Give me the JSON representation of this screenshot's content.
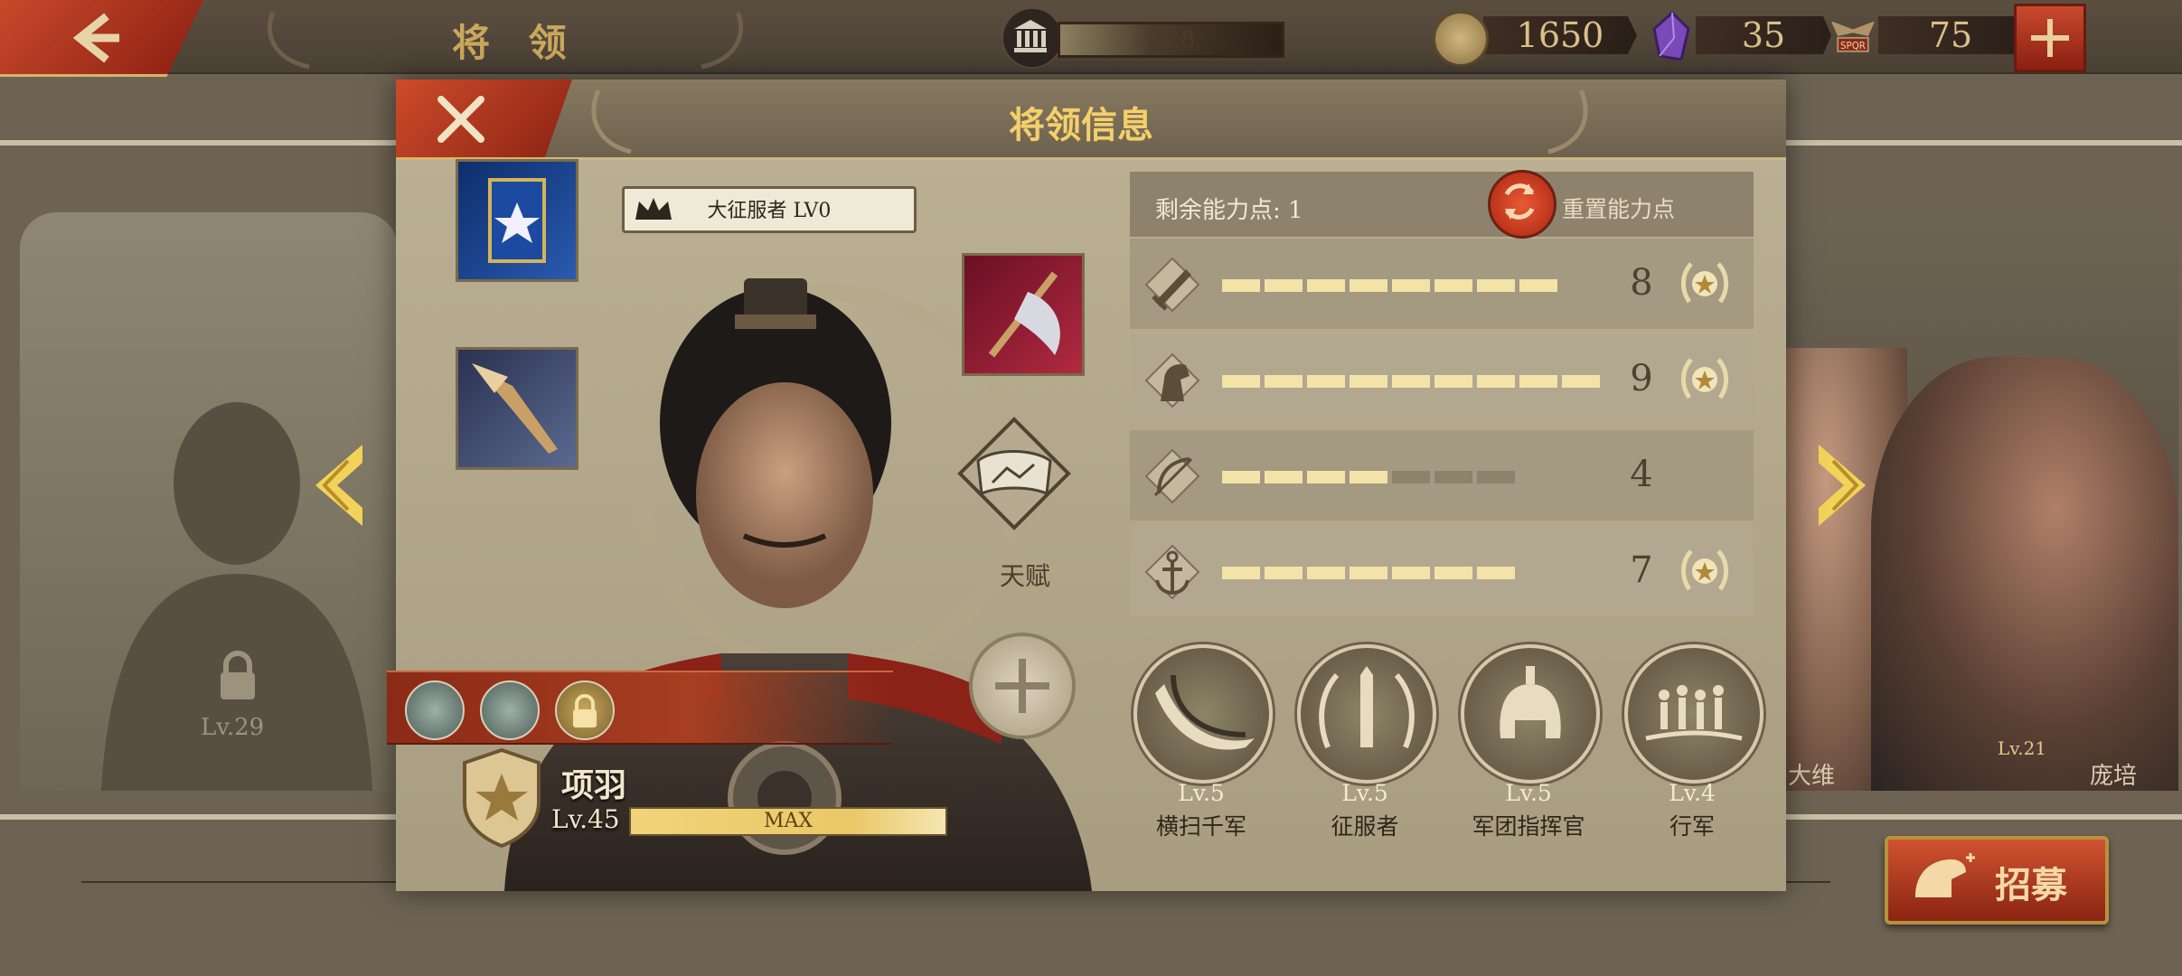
{
  "topbar": {
    "title": "将 领",
    "level_label": "Lv.8",
    "coins": "1650",
    "gems": "35",
    "tokens": "75",
    "token_icon_text": "SPQR"
  },
  "background": {
    "locked_level": "Lv.29",
    "hero_right1_name": "大维",
    "hero_right2_level": "Lv.21",
    "hero_right2_name": "庞培",
    "recruit_label": "招募"
  },
  "dialog": {
    "title": "将领信息",
    "rank_label": "大征服者 LV0",
    "talent_label": "天赋",
    "hero": {
      "name": "项羽",
      "level": "Lv.45",
      "exp_label": "MAX"
    },
    "points": {
      "remaining_label": "剩余能力点:",
      "remaining_value": "1",
      "reset_label": "重置能力点"
    },
    "stats": [
      {
        "icon": "sword-icon",
        "value": "8",
        "filled": 8,
        "total": 8,
        "medal": true
      },
      {
        "icon": "horse-icon",
        "value": "9",
        "filled": 9,
        "total": 9,
        "medal": true
      },
      {
        "icon": "bow-icon",
        "value": "4",
        "filled": 4,
        "total": 7,
        "medal": false
      },
      {
        "icon": "anchor-icon",
        "value": "7",
        "filled": 7,
        "total": 7,
        "medal": true
      }
    ],
    "skills": [
      {
        "icon": "sweep-slash-icon",
        "level": "Lv.5",
        "name": "横扫千军"
      },
      {
        "icon": "laurel-sword-icon",
        "level": "Lv.5",
        "name": "征服者"
      },
      {
        "icon": "legion-helmet-icon",
        "level": "Lv.5",
        "name": "军团指挥官"
      },
      {
        "icon": "march-soldiers-icon",
        "level": "Lv.4",
        "name": "行军"
      }
    ]
  },
  "colors": {
    "accent_red": "#a83e20",
    "gold_text": "#f4d06a",
    "bar_on": "#f3e3a8",
    "bar_off": "#8c836d"
  }
}
